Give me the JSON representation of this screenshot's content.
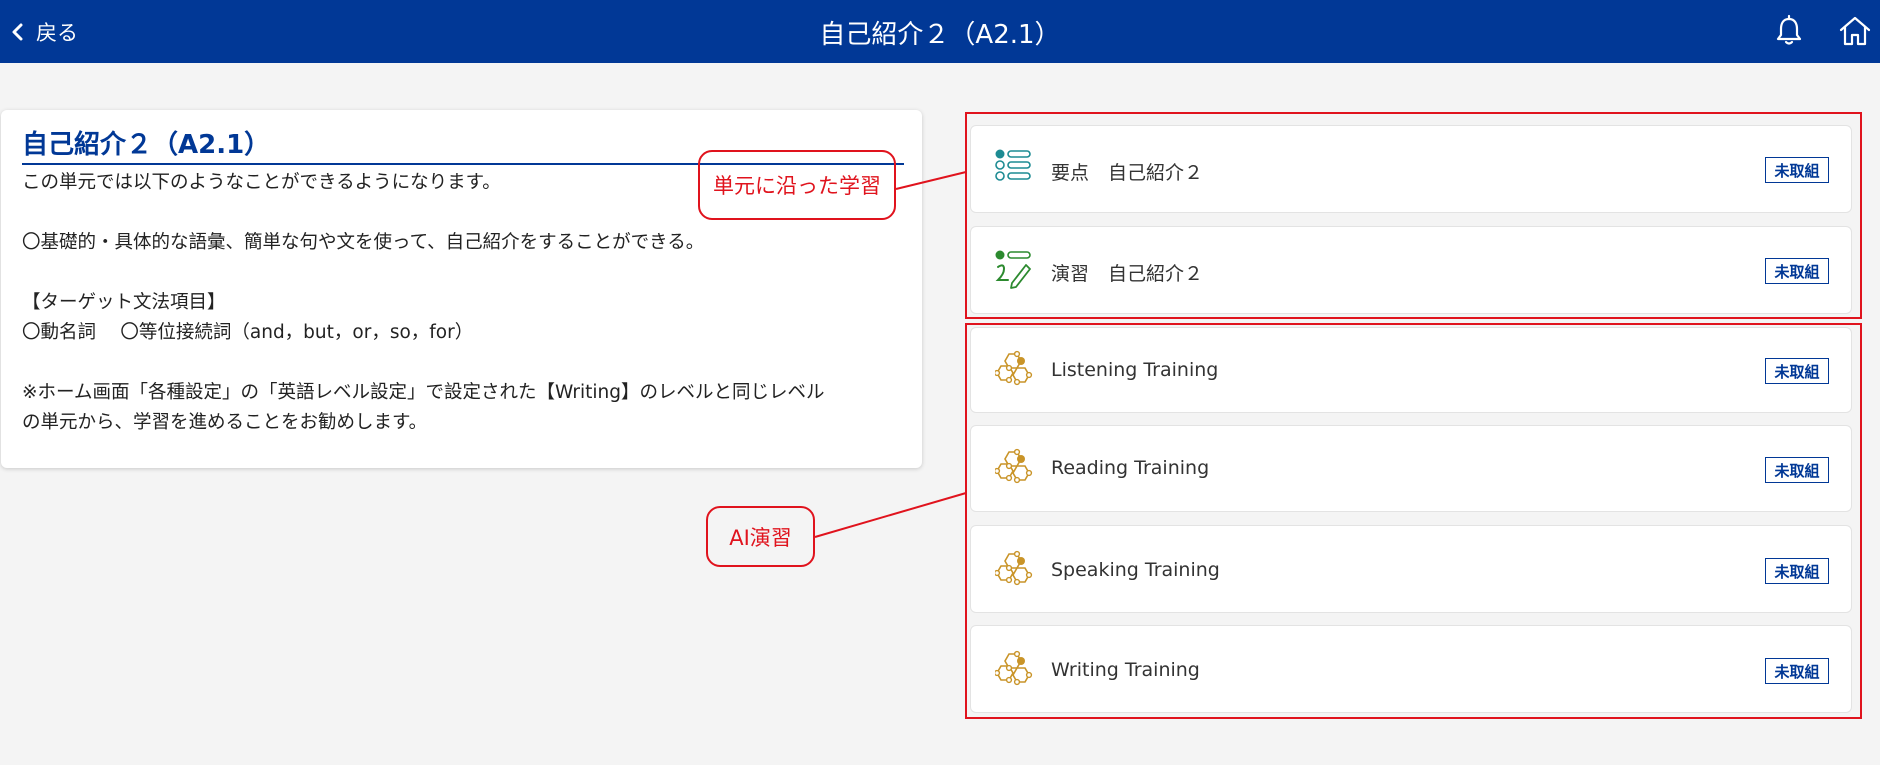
{
  "header": {
    "back_label": "戻る",
    "title": "自己紹介２（A2.1）",
    "icons": [
      "chevron-left-icon",
      "bell-icon",
      "home-icon"
    ],
    "background_color": "#013896"
  },
  "unit_info": {
    "title": "自己紹介２（A2.1）",
    "lines": [
      "この単元では以下のようなことができるようになります。",
      "",
      "〇基礎的・具体的な語彙、簡単な句や文を使って、自己紹介をすることができる。",
      "",
      "【ターゲット文法項目】",
      "〇動名詞　 〇等位接続詞（and，but，or，so，for）",
      "",
      "※ホーム画面「各種設定」の「英語レベル設定」で設定された【Writing】のレベルと同じレベル",
      "の単元から、学習を進めることをお勧めします。"
    ]
  },
  "annotations": {
    "unit_learning": "単元に沿った学習",
    "ai_practice": "AI演習",
    "color": "#e0131d"
  },
  "lessons": [
    {
      "label": "要点　自己紹介２",
      "status": "未取組",
      "icon": "key-points-list-icon"
    },
    {
      "label": "演習　自己紹介２",
      "status": "未取組",
      "icon": "practice-pencil-icon"
    },
    {
      "label": "Listening Training",
      "status": "未取組",
      "icon": "ai-network-icon"
    },
    {
      "label": "Reading Training",
      "status": "未取組",
      "icon": "ai-network-icon"
    },
    {
      "label": "Speaking Training",
      "status": "未取組",
      "icon": "ai-network-icon"
    },
    {
      "label": "Writing Training",
      "status": "未取組",
      "icon": "ai-network-icon"
    }
  ]
}
